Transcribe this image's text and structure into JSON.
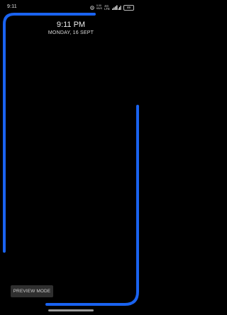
{
  "status_bar": {
    "time": "9:11",
    "net_speed_value": "0.00",
    "net_speed_unit": "KB/S",
    "network_type_top": "4G",
    "network_type_bottom": "LTE",
    "battery_level": "89"
  },
  "lockscreen": {
    "time": "9:11 PM",
    "date": "MONDAY, 16 SEPT"
  },
  "edge_lighting": {
    "color": "#1a63f0"
  },
  "preview_button": {
    "label": "PREVIEW MODE"
  },
  "icons": [
    "alarm-ring-icon",
    "signal-icon",
    "battery-icon"
  ]
}
